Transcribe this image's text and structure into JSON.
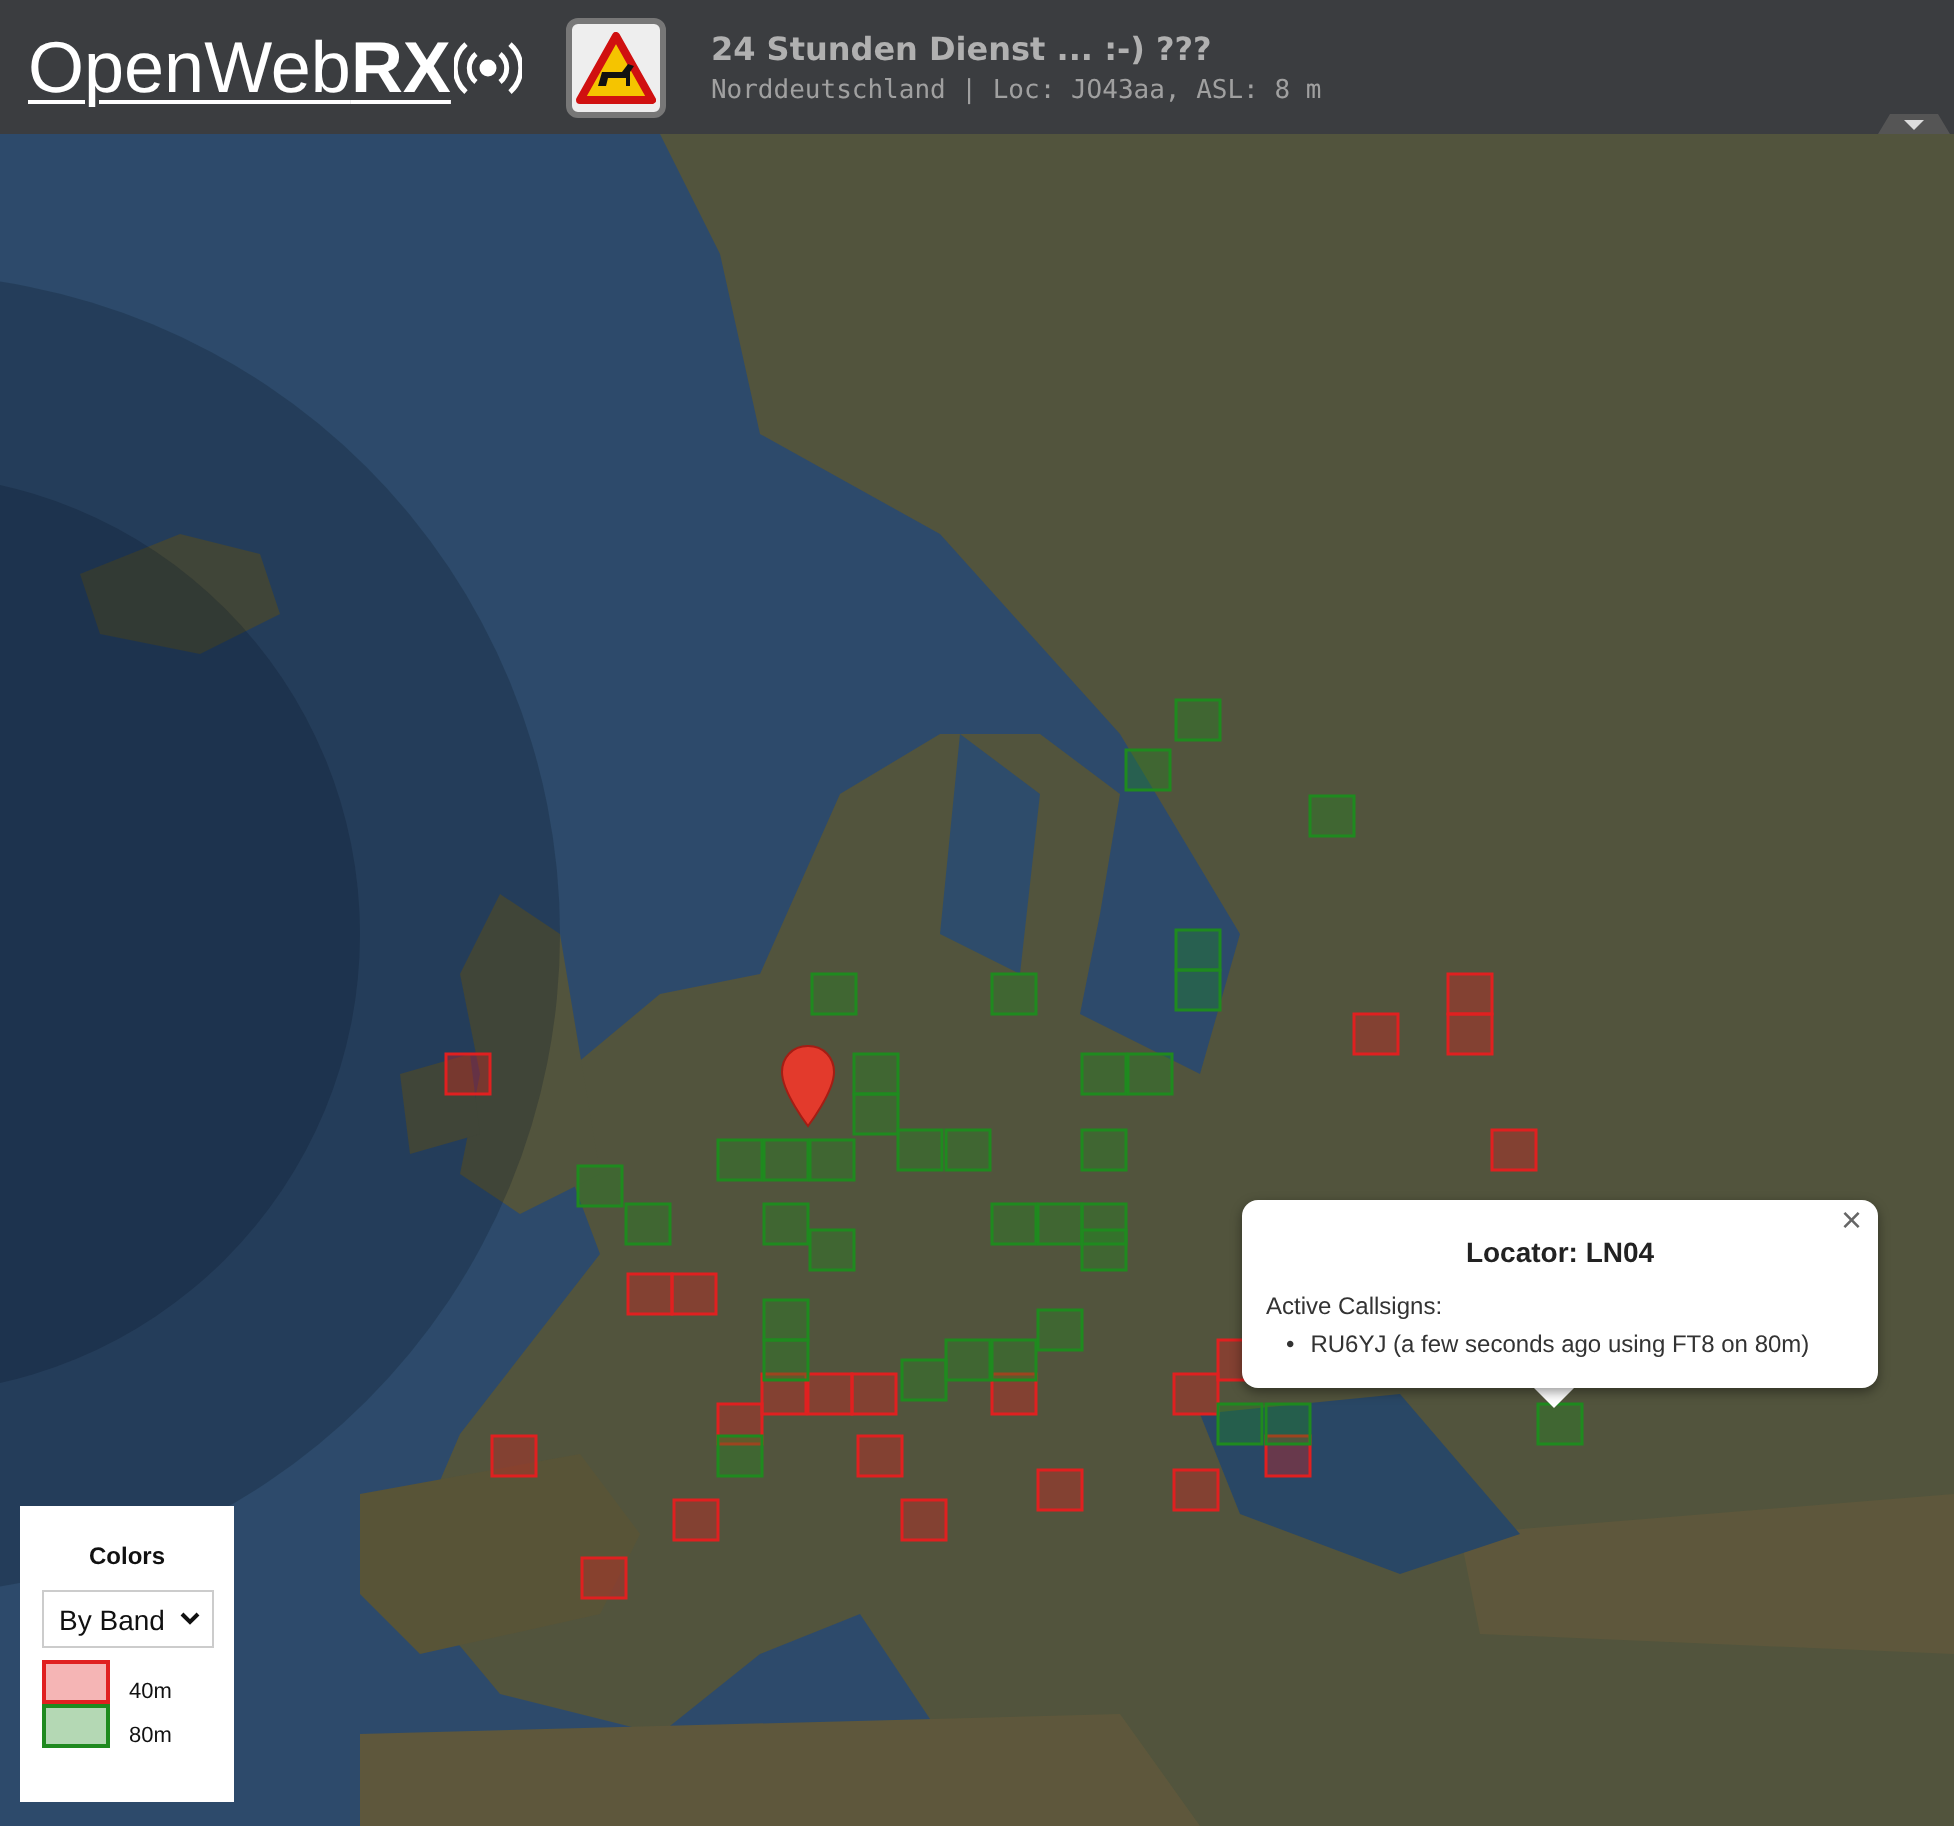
{
  "header": {
    "logo": "OpenWeb**RX**",
    "title": "24 Stunden Dienst ... :-) ???",
    "subtitle": "Norddeutschland | Loc: JO43aa, ASL: 8 m"
  },
  "map": {
    "kind": "picture",
    "grid_squares": [
      {
        "color": "#e02020"
      },
      {
        "color": "#e02020"
      },
      {
        "color": "#e02020"
      },
      {
        "color": "#e02020"
      },
      {
        "color": "#e02020"
      },
      {
        "color": "#e02020"
      },
      {
        "color": "#e02020"
      },
      {
        "color": "#e02020"
      },
      {
        "color": "#e02020"
      },
      {
        "color": "#e02020"
      },
      {
        "color": "#e02020"
      },
      {
        "color": "#e02020"
      },
      {
        "color": "#e02020"
      },
      {
        "color": "#e02020"
      },
      {
        "color": "#e02020"
      },
      {
        "color": "#e02020"
      },
      {
        "color": "#e02020"
      },
      {
        "color": "#e02020"
      },
      {
        "color": "#e02020"
      },
      {
        "color": "#e02020"
      },
      {
        "color": "#e02020"
      },
      {
        "color": "#e02020"
      },
      {
        "color": "#1f8a1f"
      },
      {
        "color": "#1f8a1f"
      },
      {
        "color": "#1f8a1f"
      },
      {
        "color": "#1f8a1f"
      },
      {
        "color": "#1f8a1f"
      },
      {
        "color": "#1f8a1f"
      },
      {
        "color": "#1f8a1f"
      },
      {
        "color": "#1f8a1f"
      },
      {
        "color": "#1f8a1f"
      },
      {
        "color": "#1f8a1f"
      },
      {
        "color": "#1f8a1f"
      },
      {
        "color": "#1f8a1f"
      },
      {
        "color": "#1f8a1f"
      },
      {
        "color": "#1f8a1f"
      },
      {
        "color": "#1f8a1f"
      },
      {
        "color": "#1f8a1f"
      },
      {
        "color": "#1f8a1f"
      },
      {
        "color": "#1f8a1f"
      },
      {
        "color": "#1f8a1f"
      },
      {
        "color": "#1f8a1f"
      },
      {
        "color": "#1f8a1f"
      },
      {
        "color": "#1f8a1f"
      },
      {
        "color": "#1f8a1f"
      },
      {
        "color": "#1f8a1f"
      },
      {
        "color": "#1f8a1f"
      },
      {
        "color": "#1f8a1f"
      },
      {
        "color": "#1f8a1f"
      },
      {
        "color": "#1f8a1f"
      },
      {
        "color": "#1f8a1f"
      },
      {
        "color": "#1f8a1f"
      },
      {
        "color": "#1f8a1f"
      },
      {
        "color": "#1f8a1f"
      },
      {
        "color": "#1f8a1f"
      },
      {
        "color": "#1f8a1f"
      },
      {
        "color": "#1f8a1f"
      }
    ]
  },
  "popup": {
    "close": "×",
    "title": "Locator: LN04",
    "label": "Active Callsigns:",
    "bullet": "•",
    "items": [
      "RU6YJ (a few seconds ago using FT8 on 80m)"
    ]
  },
  "legend": {
    "title": "Colors",
    "select": "By Band",
    "items": [
      {
        "label": "40m",
        "color": "#e02020"
      },
      {
        "label": "80m",
        "color": "#1f8a1f"
      }
    ]
  }
}
